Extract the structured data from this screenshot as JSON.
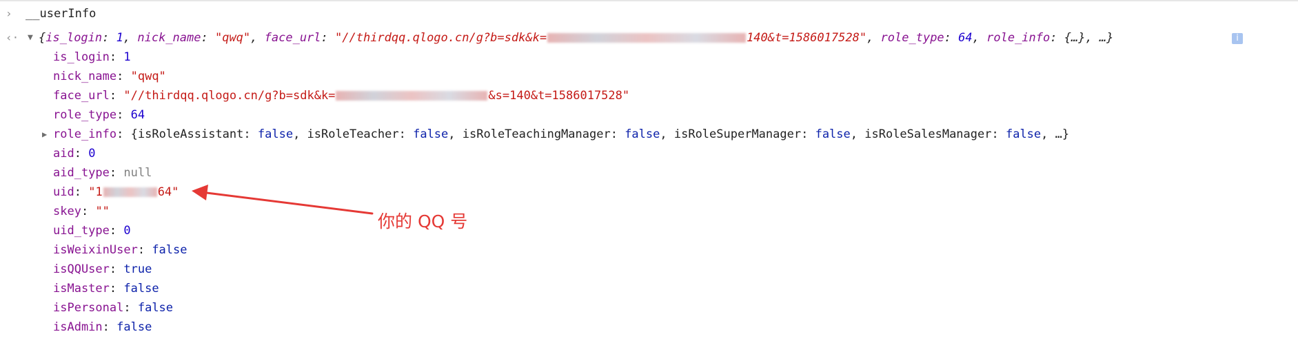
{
  "console": {
    "input": {
      "prompt_glyph": "›",
      "text": "__userInfo"
    },
    "result": {
      "return_glyph": "‹·",
      "expand_glyph": "▼",
      "summary": {
        "open": "{",
        "is_login_key": "is_login",
        "is_login_val": "1",
        "nick_name_key": "nick_name",
        "nick_name_val": "\"qwq\"",
        "face_url_key": "face_url",
        "face_url_val_a": "\"//thirdqq.qlogo.cn/g?b=sdk&k=",
        "face_url_val_b": "140&t=1586017528\"",
        "role_type_key": "role_type",
        "role_type_val": "64",
        "role_info_key": "role_info",
        "role_info_val": "{…}",
        "tail": ", …}"
      },
      "info_icon_glyph": "i"
    },
    "properties": {
      "is_login": {
        "key": "is_login",
        "value": "1"
      },
      "nick_name": {
        "key": "nick_name",
        "value": "\"qwq\""
      },
      "face_url": {
        "key": "face_url",
        "value_a": "\"//thirdqq.qlogo.cn/g?b=sdk&k=",
        "value_b": "&s=140&t=1586017528\""
      },
      "role_type": {
        "key": "role_type",
        "value": "64"
      },
      "role_info": {
        "caret": "▶",
        "key": "role_info",
        "open": "{",
        "k1": "isRoleAssistant",
        "v1": "false",
        "k2": "isRoleTeacher",
        "v2": "false",
        "k3": "isRoleTeachingManager",
        "v3": "false",
        "k4": "isRoleSuperManager",
        "v4": "false",
        "k5": "isRoleSalesManager",
        "v5": "false",
        "tail": ", …}"
      },
      "aid": {
        "key": "aid",
        "value": "0"
      },
      "aid_type": {
        "key": "aid_type",
        "value": "null"
      },
      "uid": {
        "key": "uid",
        "value_a": "\"1",
        "value_b": "64\""
      },
      "skey": {
        "key": "skey",
        "value": "\"\""
      },
      "uid_type": {
        "key": "uid_type",
        "value": "0"
      },
      "isWeixinUser": {
        "key": "isWeixinUser",
        "value": "false"
      },
      "isQQUser": {
        "key": "isQQUser",
        "value": "true"
      },
      "isMaster": {
        "key": "isMaster",
        "value": "false"
      },
      "isPersonal": {
        "key": "isPersonal",
        "value": "false"
      },
      "isAdmin": {
        "key": "isAdmin",
        "value": "false"
      }
    }
  },
  "annotation": {
    "text": "你的 QQ 号",
    "color": "#e53935"
  },
  "colors": {
    "key": "#881391",
    "string": "#c41a16",
    "number": "#1c00cf",
    "boolean": "#0d22aa",
    "null": "#808080"
  }
}
